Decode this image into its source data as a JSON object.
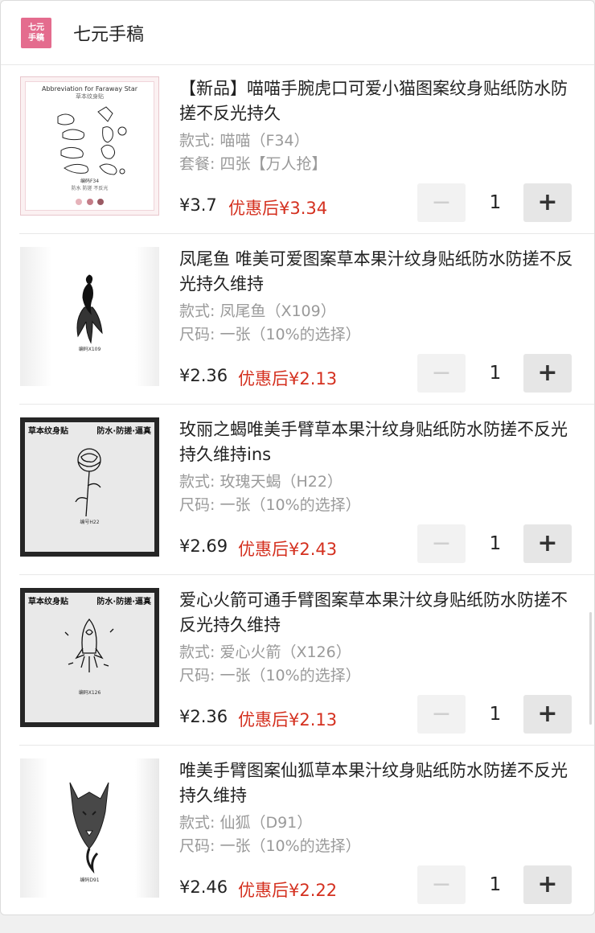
{
  "shop": {
    "logo_line1": "七元",
    "logo_line2": "手稿",
    "name": "七元手稿"
  },
  "colors": {
    "brand_pink": "#e46c8e",
    "promo_red": "#d4301f",
    "spec_gray": "#9a9a9a"
  },
  "items": [
    {
      "title": "【新品】喵喵手腕虎口可爱小猫图案纹身贴纸防水防搓不反光持久",
      "spec1": "款式: 喵喵（F34）",
      "spec2": "套餐: 四张【万人抢】",
      "price": "¥3.7",
      "promo": "优惠后¥3.34",
      "qty": "1",
      "minus": "−",
      "plus": "+",
      "thumb_caption": "Abbreviation for Faraway Star",
      "thumb_sub": "草本纹身贴",
      "thumb_code": "编码F34",
      "thumb_note": "防水 防搓 不反光"
    },
    {
      "title": "凤尾鱼 唯美可爱图案草本果汁纹身贴纸防水防搓不反光持久维持",
      "spec1": "款式: 凤尾鱼（X109）",
      "spec2": "尺码: 一张（10%的选择）",
      "price": "¥2.36",
      "promo": "优惠后¥2.13",
      "qty": "1",
      "minus": "−",
      "plus": "+",
      "thumb_code": "编码X109"
    },
    {
      "title": "玫丽之蝎唯美手臂草本果汁纹身贴纸防水防搓不反光持久维持ins",
      "spec1": "款式: 玫瑰天蝎（H22）",
      "spec2": "尺码: 一张（10%的选择）",
      "price": "¥2.69",
      "promo": "优惠后¥2.43",
      "qty": "1",
      "minus": "−",
      "plus": "+",
      "thumb_banner": "草本纹身贴",
      "thumb_banner2": "防水·防搓·逼真",
      "thumb_code": "编号H22"
    },
    {
      "title": "爱心火箭可通手臂图案草本果汁纹身贴纸防水防搓不反光持久维持",
      "spec1": "款式: 爱心火箭（X126）",
      "spec2": "尺码: 一张（10%的选择）",
      "price": "¥2.36",
      "promo": "优惠后¥2.13",
      "qty": "1",
      "minus": "−",
      "plus": "+",
      "thumb_banner": "草本纹身贴",
      "thumb_banner2": "防水·防搓·逼真",
      "thumb_code": "编码X126"
    },
    {
      "title": "唯美手臂图案仙狐草本果汁纹身贴纸防水防搓不反光持久维持",
      "spec1": "款式: 仙狐（D91）",
      "spec2": "尺码: 一张（10%的选择）",
      "price": "¥2.46",
      "promo": "优惠后¥2.22",
      "qty": "1",
      "minus": "−",
      "plus": "+",
      "thumb_code": "编码D91"
    }
  ]
}
